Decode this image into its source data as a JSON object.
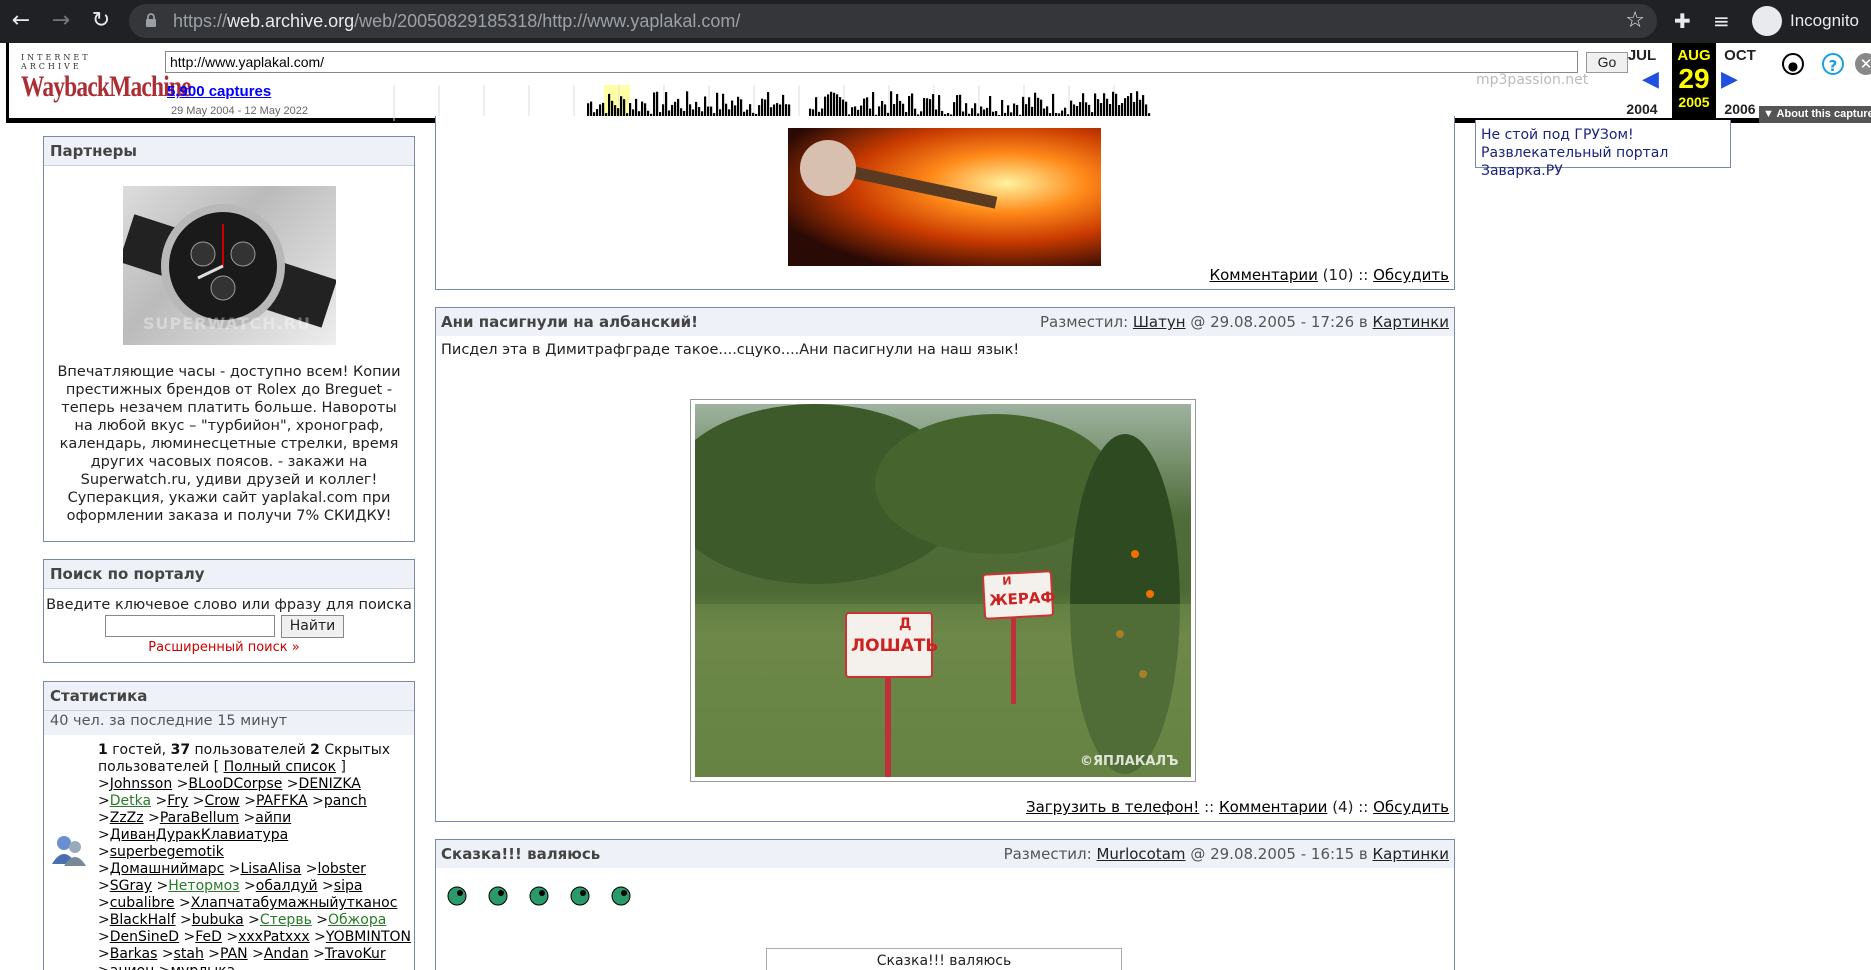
{
  "browser": {
    "url_prefix": "https://",
    "url_host": "web.archive.org",
    "url_path": "/web/20050829185318/http://www.yaplakal.com/",
    "incognito_label": "Incognito"
  },
  "wayback": {
    "logo_top": "INTERNET ARCHIVE",
    "logo_main": "WaybackMachine",
    "url_value": "http://www.yaplakal.com/",
    "go_label": "Go",
    "captures": "5,900 captures",
    "range": "29 May 2004 - 12 May 2022",
    "prev_month": "JUL",
    "cur_month": "AUG",
    "next_month": "OCT",
    "prev_year": "2004",
    "cur_day": "29",
    "cur_year": "2005",
    "next_year": "2006",
    "about": "▼ About this capture",
    "accent": "#ab2e33",
    "highlight": "#ffff00"
  },
  "right_panel": {
    "ghost": "mp3passion.net",
    "links": [
      "Не стой под ГРУЗом!",
      "Развлекательный портал Заварка.РУ"
    ]
  },
  "partners": {
    "title": "Партнеры",
    "image_watermark": "SUPERWATCH.RU",
    "text": "Впечатляющие часы - доступно всем! Копии престижных брендов от Rolex до Breguet - теперь незачем платить больше. Навороты на любой вкус – \"турбийон\", хронограф, календарь, люминесцетные стрелки, время других часовых поясов. - закажи на Superwatch.ru, удиви друзей и коллег! Суперакция, укажи сайт yaplakal.com при оформлении заказа и получи 7% СКИДКУ!"
  },
  "search": {
    "title": "Поиск по порталу",
    "prompt": "Введите ключевое слово или фразу для поиска",
    "button": "Найти",
    "advanced": "Расширенный поиск »"
  },
  "stats": {
    "title": "Статистика",
    "recent": "40 чел. за последние 15 минут",
    "guests_num": "1",
    "guests_txt": " гостей, ",
    "users_num": "37",
    "users_txt": " пользователей ",
    "hidden_num": "2",
    "hidden_txt": " Скрытых пользователей [ ",
    "full_list": "Полный список",
    "close_bracket": " ]",
    "users": [
      [
        ">",
        "Johnsson",
        " >",
        "BLooDCorpse",
        " >",
        "DENIZKA"
      ],
      [
        ">",
        "Detka",
        " >",
        "Fry",
        " >",
        "Crow",
        " >",
        "PAFFKA",
        " >",
        "panch"
      ],
      [
        ">",
        "ZzZz",
        " >",
        "ParaBellum",
        " >",
        "айпи"
      ],
      [
        ">",
        "ДиванДуракКлавиатура",
        " >",
        "superbegemotik"
      ],
      [
        ">",
        "Домашниймарс",
        " >",
        "LisaAlisa",
        " >",
        "lobster"
      ],
      [
        ">",
        "SGray",
        " >",
        "Нетормоз",
        " >",
        "обалдуй",
        " >",
        "sipa"
      ],
      [
        ">",
        "cubalibre",
        " >",
        "Хлапчатабумажныйутканос"
      ],
      [
        ">",
        "BlackHalf",
        " >",
        "bubuka",
        " >",
        "Стервь",
        " >",
        "Обжора"
      ],
      [
        ">",
        "DenSineD",
        " >",
        "FeD",
        " >",
        "xxxPatxxx",
        " >",
        "YOBMINTON"
      ],
      [
        ">",
        "Barkas",
        " >",
        "stah",
        " >",
        "PAN",
        " >",
        "Andan",
        " >",
        "TravoKur"
      ],
      [
        ">",
        "анион",
        " >",
        "мурлыка"
      ]
    ]
  },
  "post_top": {
    "comments": "Комментарии",
    "count": " (10) :: ",
    "discuss": "Обсудить"
  },
  "post_albanian": {
    "title": "Ани пасигнули на албанский!",
    "posted_by": "Разместил: ",
    "author": "Шатун",
    "date": " @ 29.08.2005 - 17:26 в ",
    "category": "Картинки",
    "body": "Писдел эта в Димитрафграде такое....сцуко....Ани пасигнули на наш язык!",
    "sign1": "ЛОШАТЬ",
    "sign1_fix": "Д",
    "sign2": "ЖЕРАФ",
    "sign2_fix": "И",
    "watermark": "©ЯПЛАКАЛЪ",
    "upload": "Загрузить в телефон!",
    "sep1": " :: ",
    "comments": "Комментарии",
    "count": " (4) :: ",
    "discuss": "Обсудить"
  },
  "post_fairy": {
    "title": "Сказка!!! валяюсь",
    "posted_by": "Разместил: ",
    "author": "Murlocotam",
    "date": " @ 29.08.2005 - 16:15 в ",
    "category": "Картинки",
    "img_alt": "Сказка!!! валяюсь"
  }
}
